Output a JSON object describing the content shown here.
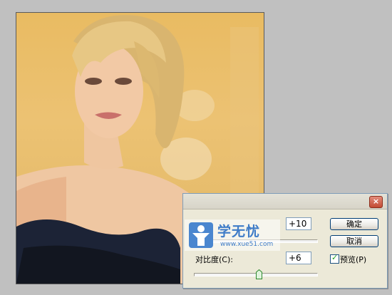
{
  "dialog": {
    "close_label": "×",
    "value1": "+10",
    "value2": "+6",
    "contrast_label": "对比度(C):",
    "ok_label": "确定",
    "cancel_label": "取消",
    "preview_label": "预览(P)",
    "preview_checked": true,
    "contrast_slider_level": 0.53
  },
  "watermark": {
    "title": "学无忧",
    "url": "www.xue51.com"
  },
  "colors": {
    "dialog_bg": "#ece9d8",
    "close_red": "#c24b34",
    "watermark_blue": "#3f7cc8"
  }
}
